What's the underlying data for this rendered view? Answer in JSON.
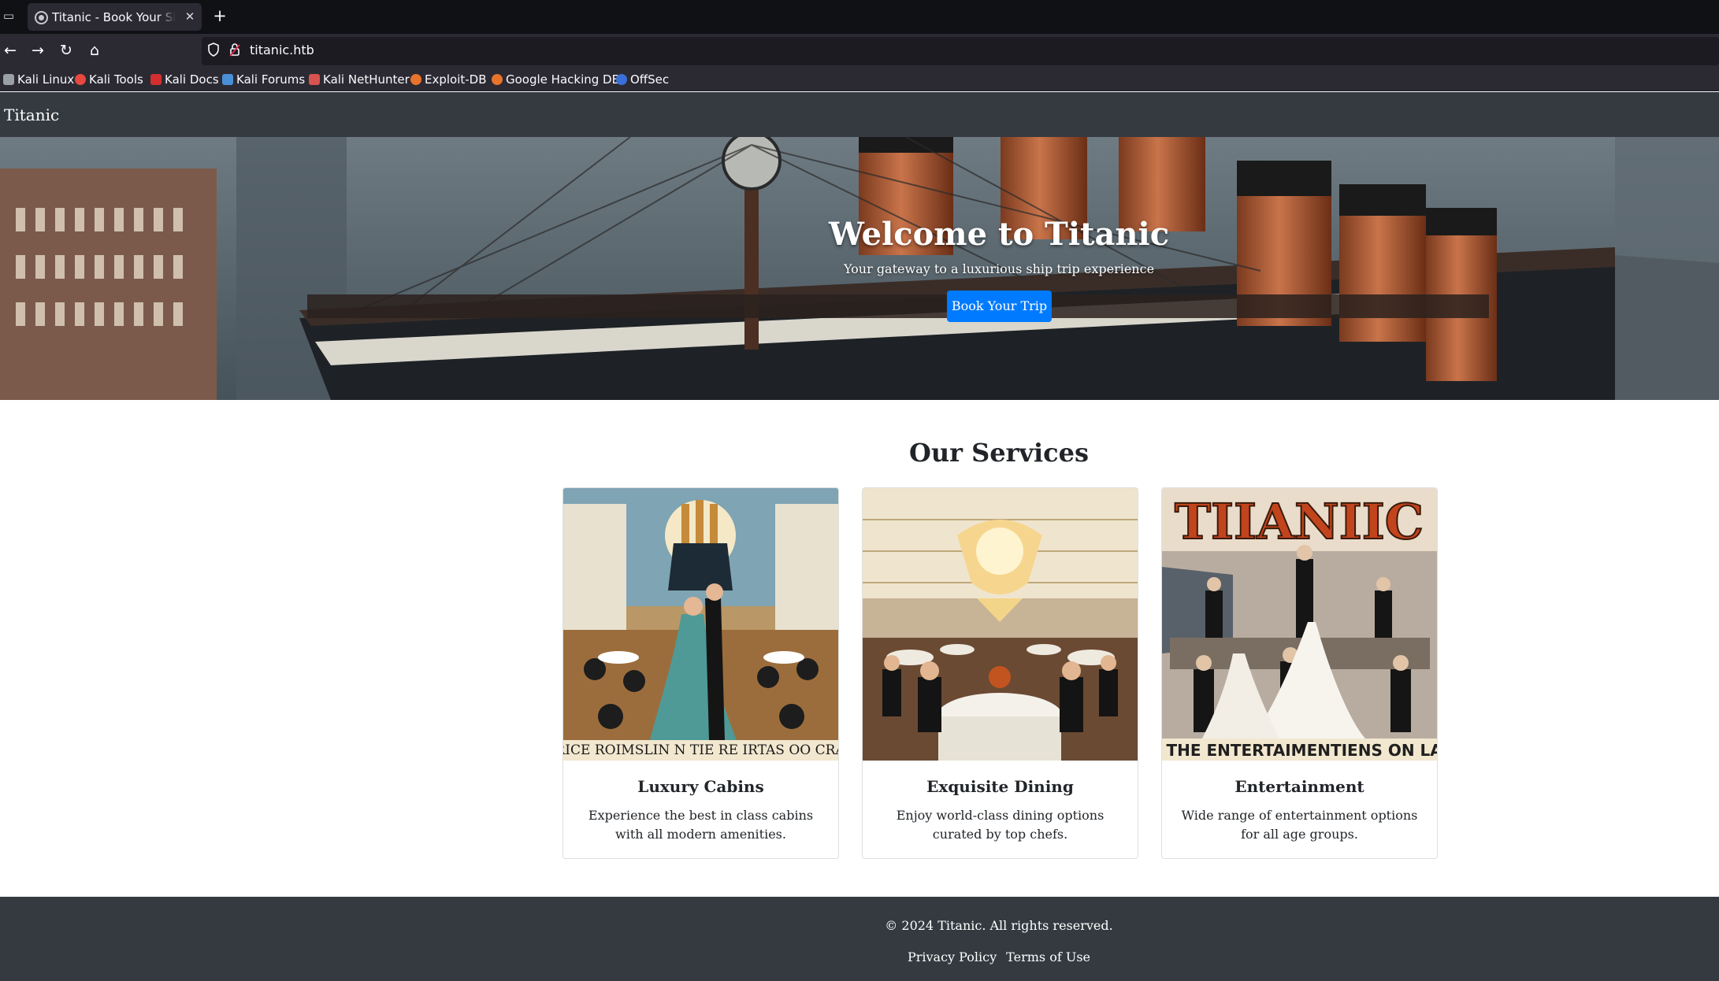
{
  "browser": {
    "tab": {
      "title": "Titanic - Book Your Ship Trip"
    },
    "url": "titanic.htb",
    "bookmarks": [
      {
        "label": "Kali Linux",
        "icon": "kali-dragon-icon",
        "color": "#9aa0a6"
      },
      {
        "label": "Kali Tools",
        "icon": "kali-tools-icon",
        "color": "#e8493f"
      },
      {
        "label": "Kali Docs",
        "icon": "kali-docs-icon",
        "color": "#d32f2f"
      },
      {
        "label": "Kali Forums",
        "icon": "kali-forums-icon",
        "color": "#4a90d9"
      },
      {
        "label": "Kali NetHunter",
        "icon": "kali-nethunter-icon",
        "color": "#d9534f"
      },
      {
        "label": "Exploit-DB",
        "icon": "exploit-db-icon",
        "color": "#e8732b"
      },
      {
        "label": "Google Hacking DB",
        "icon": "ghdb-icon",
        "color": "#e8732b"
      },
      {
        "label": "OffSec",
        "icon": "offsec-icon",
        "color": "#3b6fd8"
      }
    ]
  },
  "site": {
    "brand": "Titanic",
    "hero": {
      "title": "Welcome to Titanic",
      "subtitle": "Your gateway to a luxurious ship trip experience",
      "button": "Book Your Trip"
    },
    "services": {
      "title": "Our Services",
      "cards": [
        {
          "title": "Luxury Cabins",
          "text": "Experience the best in class cabins with all modern amenities.",
          "image": "luxury-cabins-image",
          "caption": "TTRICE ROIMSLIN N TIE RE IRTAS OO CRAS I"
        },
        {
          "title": "Exquisite Dining",
          "text": "Enjoy world-class dining options curated by top chefs.",
          "image": "dining-hall-image"
        },
        {
          "title": "Entertainment",
          "text": "Wide range of entertainment options for all age groups.",
          "image": "entertainment-poster-image",
          "poster_title": "TIIANIIC",
          "caption": "E THE ENTERTAIMENTIENS ON LAI"
        }
      ]
    },
    "footer": {
      "copyright": "© 2024 Titanic. All rights reserved.",
      "links": [
        "Privacy Policy",
        "Terms of Use"
      ]
    },
    "colors": {
      "primary_button": "#007bff",
      "nav_bg": "#343a40",
      "text": "#212529"
    }
  }
}
